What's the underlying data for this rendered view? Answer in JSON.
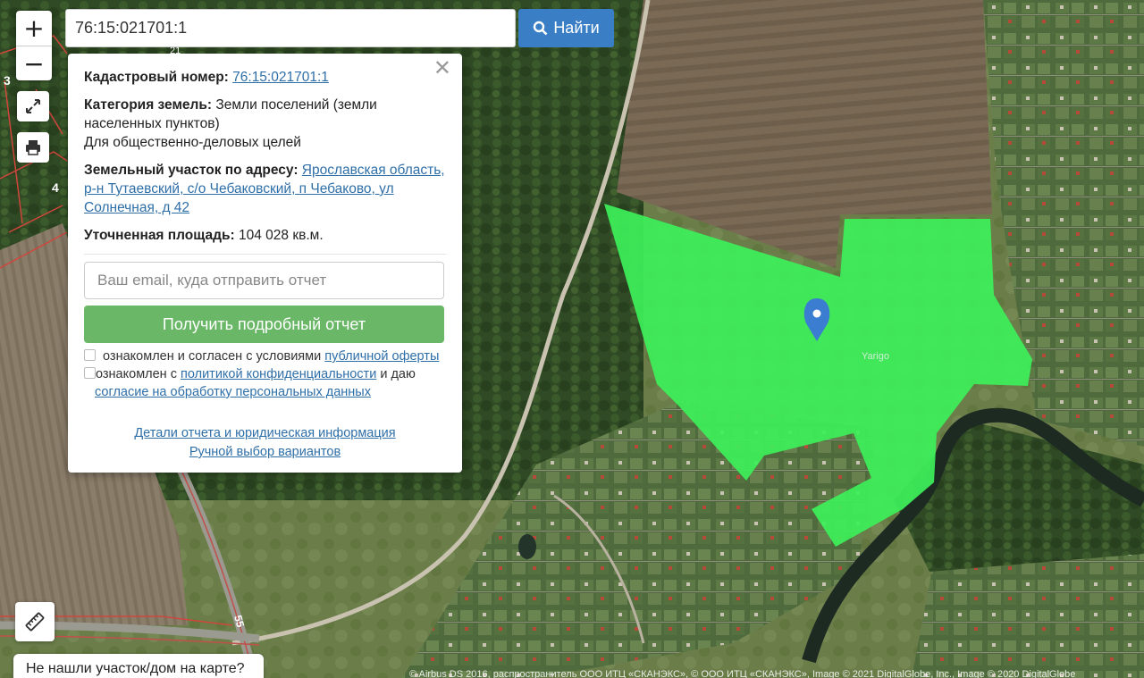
{
  "search": {
    "value": "76:15:021701:1",
    "button_label": "Найти"
  },
  "map_controls": {
    "zoom_in": "+",
    "zoom_out": "−"
  },
  "map_labels": {
    "parcel_3": "3",
    "parcel_4": "4",
    "road_55": "55",
    "road_21": "21",
    "place_label": "Yarigo"
  },
  "popup": {
    "cadastral_label": "Кадастровый номер:",
    "cadastral_value": "76:15:021701:1",
    "category_label": "Категория земель:",
    "category_value": "Земли поселений (земли населенных пунктов)",
    "purpose": "Для общественно-деловых целей",
    "address_label": "Земельный участок по адресу:",
    "address_value": "Ярославская область, р-н Тутаевский, с/о Чебаковский, п Чебаково, ул Солнечная, д 42",
    "area_label": "Уточненная площадь:",
    "area_value": "104 028 кв.м.",
    "email_placeholder": "Ваш email, куда отправить отчет",
    "report_button": "Получить подробный отчет",
    "consent1_text": "ознакомлен и согласен с условиями",
    "consent1_link": "публичной оферты",
    "consent2_text_a": "ознакомлен с",
    "consent2_link_a": "политикой конфиденциальности",
    "consent2_text_b": "и даю",
    "consent2_link_b": "согласие на обработку персональных данных",
    "details_link": "Детали отчета и юридическая информация",
    "manual_link": "Ручной выбор вариантов"
  },
  "not_found": "Не нашли участок/дом на карте?",
  "attribution": "© Airbus DS 2016, распространитель ООО ИТЦ «СКАНЭКС», © ООО ИТЦ «СКАНЭКС», Image © 2021 DigitalGlobe, Inc., Image © 2020 DigitalGlobe",
  "colors": {
    "parcel_fill": "#3df05a",
    "marker": "#3b7dd0",
    "search_button": "#3a7fc6",
    "report_button": "#6ab867",
    "link": "#2f6fa8"
  },
  "icons": {
    "zoom_in": "plus-icon",
    "zoom_out": "minus-icon",
    "fullscreen": "expand-icon",
    "print": "printer-icon",
    "search": "search-icon",
    "close": "close-icon",
    "ruler": "ruler-icon",
    "marker": "map-pin-icon"
  }
}
